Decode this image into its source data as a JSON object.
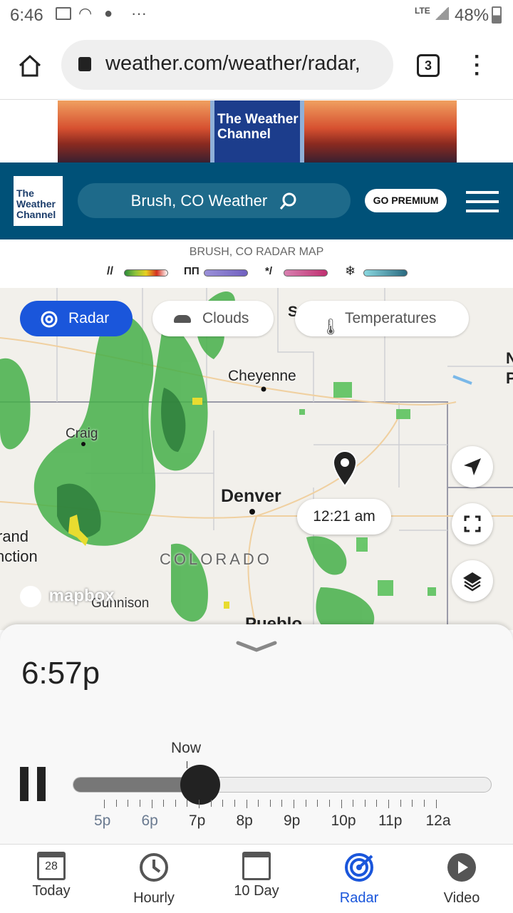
{
  "status_bar": {
    "time": "6:46",
    "network": "LTE",
    "battery": "48%"
  },
  "browser": {
    "url": "weather.com/weather/radar,",
    "tab_count": "3"
  },
  "ad": {
    "logo_text": "The Weather Channel"
  },
  "header": {
    "logo_line1": "The",
    "logo_line2": "Weather",
    "logo_line3": "Channel",
    "search_text": "Brush, CO Weather",
    "premium_label": "GO PREMIUM"
  },
  "legend": {
    "title": "BRUSH, CO RADAR MAP"
  },
  "map": {
    "chips": {
      "radar": "Radar",
      "clouds": "Clouds",
      "temperatures": "Temperatures"
    },
    "cities": {
      "cheyenne": "Cheyenne",
      "craig": "Craig",
      "denver": "Denver",
      "gunnison": "Gunnison",
      "state": "COLORADO",
      "left_partial1": "rand",
      "left_partial2": "nction",
      "bottom_partial": "Pueblo",
      "edge_s": "S",
      "edge_n": "N",
      "edge_p": "P"
    },
    "marker_time": "12:21 am",
    "attribution": "mapbox"
  },
  "player": {
    "current_time": "6:57p",
    "now_label": "Now",
    "progress": 0.305,
    "hours": [
      "5p",
      "6p",
      "7p",
      "8p",
      "9p",
      "10p",
      "11p",
      "12a"
    ]
  },
  "bottom_nav": {
    "calendar_day": "28",
    "items": [
      "Today",
      "Hourly",
      "10 Day",
      "Radar",
      "Video"
    ]
  },
  "colors": {
    "brand": "#005178",
    "accent": "#1a56db"
  }
}
